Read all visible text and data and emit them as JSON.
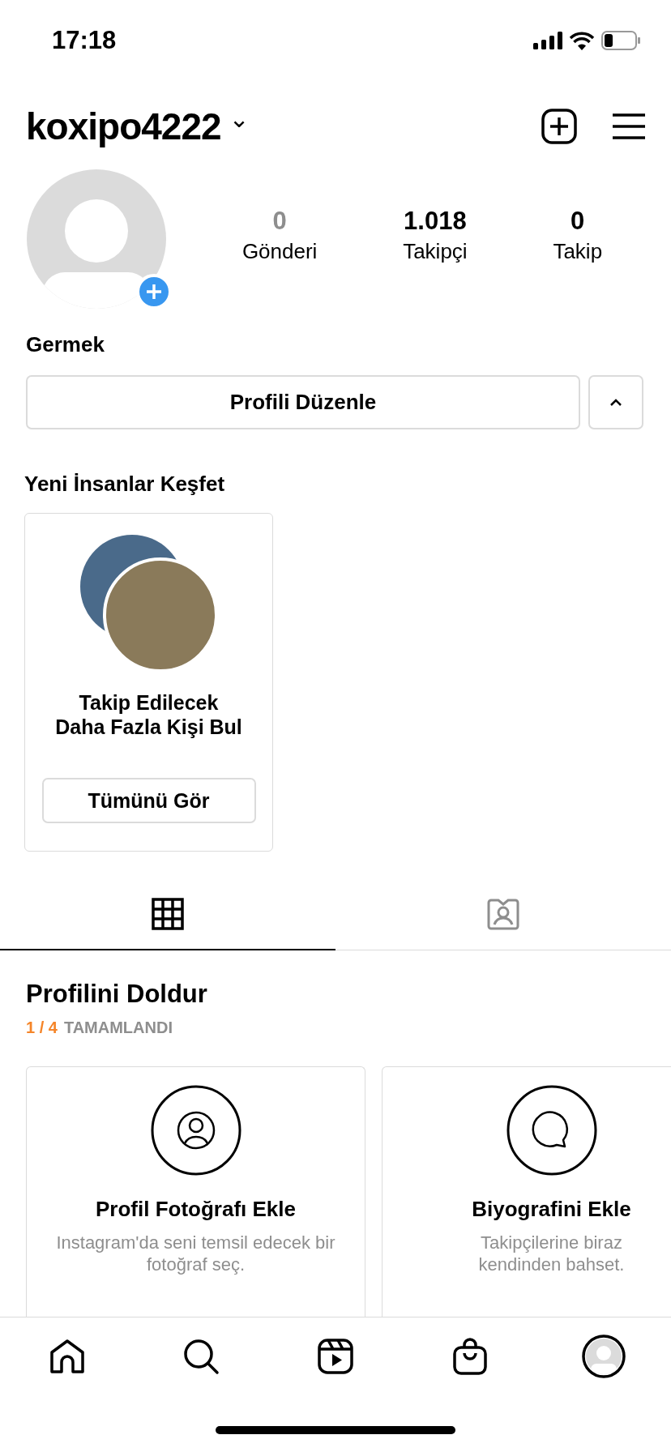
{
  "status_bar": {
    "time": "17:18"
  },
  "header": {
    "username": "koxipo4222",
    "caret": "⌄"
  },
  "stats": [
    {
      "value": "0",
      "label": "Gönderi",
      "muted": true
    },
    {
      "value": "1.018",
      "label": "Takipçi",
      "muted": false
    },
    {
      "value": "0",
      "label": "Takip",
      "muted": false
    }
  ],
  "display_name": "Germek",
  "edit_button": "Profili Düzenle",
  "discover": {
    "title": "Yeni İnsanlar Keşfet",
    "card_text": "Takip Edilecek\nDaha Fazla Kişi Bul",
    "button": "Tümünü Gör"
  },
  "tabs": [
    {
      "kind": "grid",
      "selected": true
    },
    {
      "kind": "tagged",
      "selected": false
    }
  ],
  "complete_profile": {
    "title": "Profilini Doldur",
    "progress": "1 / 4",
    "progress_label": "TAMAMLANDI",
    "cards": [
      {
        "kind": "photo",
        "title": "Profil Fotoğrafı Ekle",
        "text": "Instagram'da seni temsil edecek bir fotoğraf seç."
      },
      {
        "kind": "bio",
        "title": "Biyografini Ekle",
        "text": "Takipçilerine biraz kendinden bahset."
      }
    ]
  },
  "nav": [
    {
      "kind": "home",
      "selected": false
    },
    {
      "kind": "search",
      "selected": false
    },
    {
      "kind": "reels",
      "selected": false
    },
    {
      "kind": "shop",
      "selected": false
    },
    {
      "kind": "profile",
      "selected": true
    }
  ]
}
